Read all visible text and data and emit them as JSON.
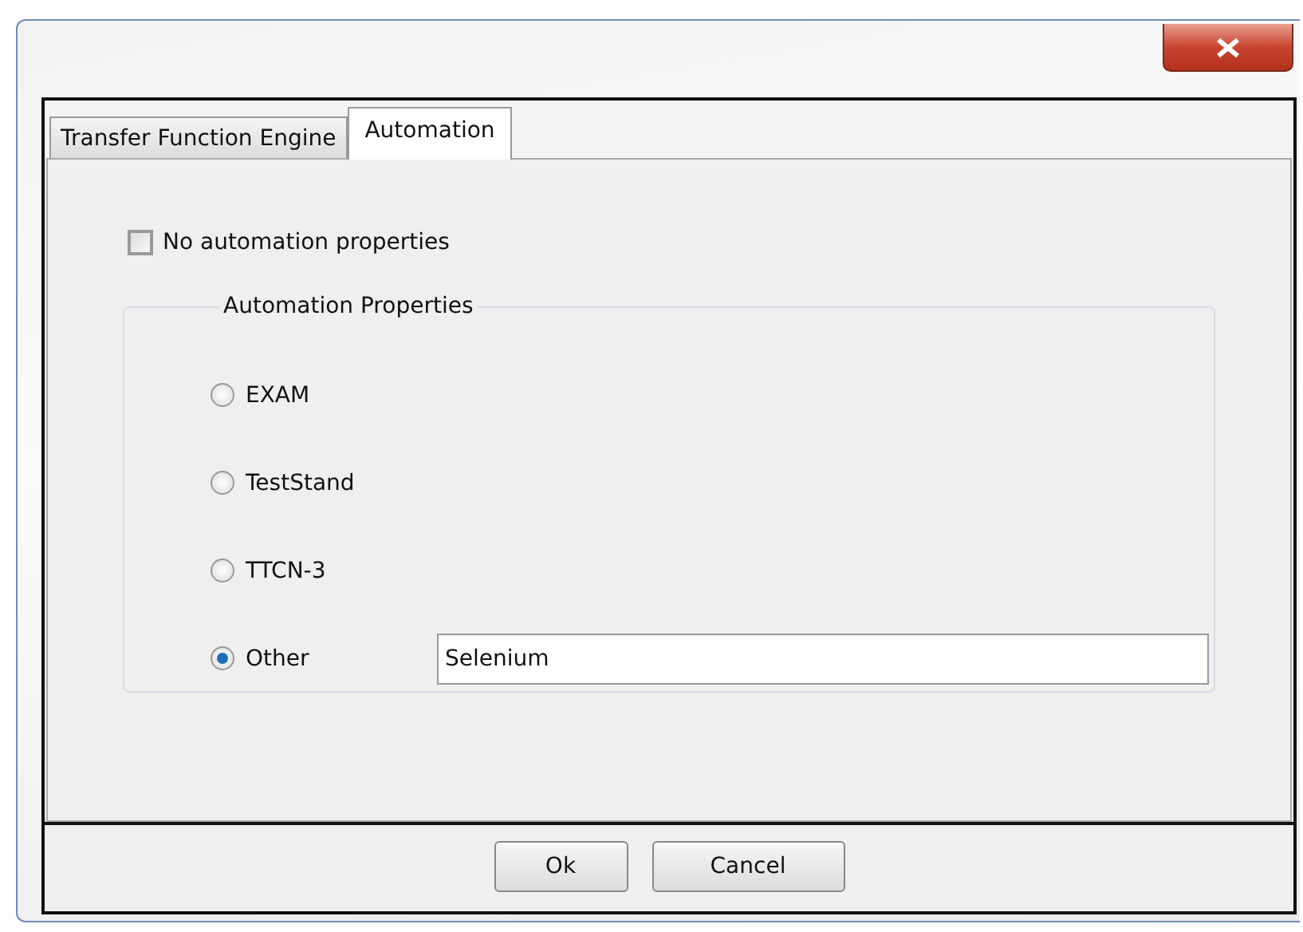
{
  "tabs": [
    {
      "label": "Transfer Function Engine",
      "selected": false
    },
    {
      "label": "Automation",
      "selected": true
    }
  ],
  "checkbox": {
    "label": "No automation properties",
    "checked": false
  },
  "group": {
    "title": "Automation Properties",
    "options": [
      {
        "label": "EXAM",
        "selected": false
      },
      {
        "label": "TestStand",
        "selected": false
      },
      {
        "label": "TTCN-3",
        "selected": false
      },
      {
        "label": "Other",
        "selected": true,
        "value": "Selenium"
      }
    ]
  },
  "buttons": [
    "Ok",
    "Cancel"
  ]
}
